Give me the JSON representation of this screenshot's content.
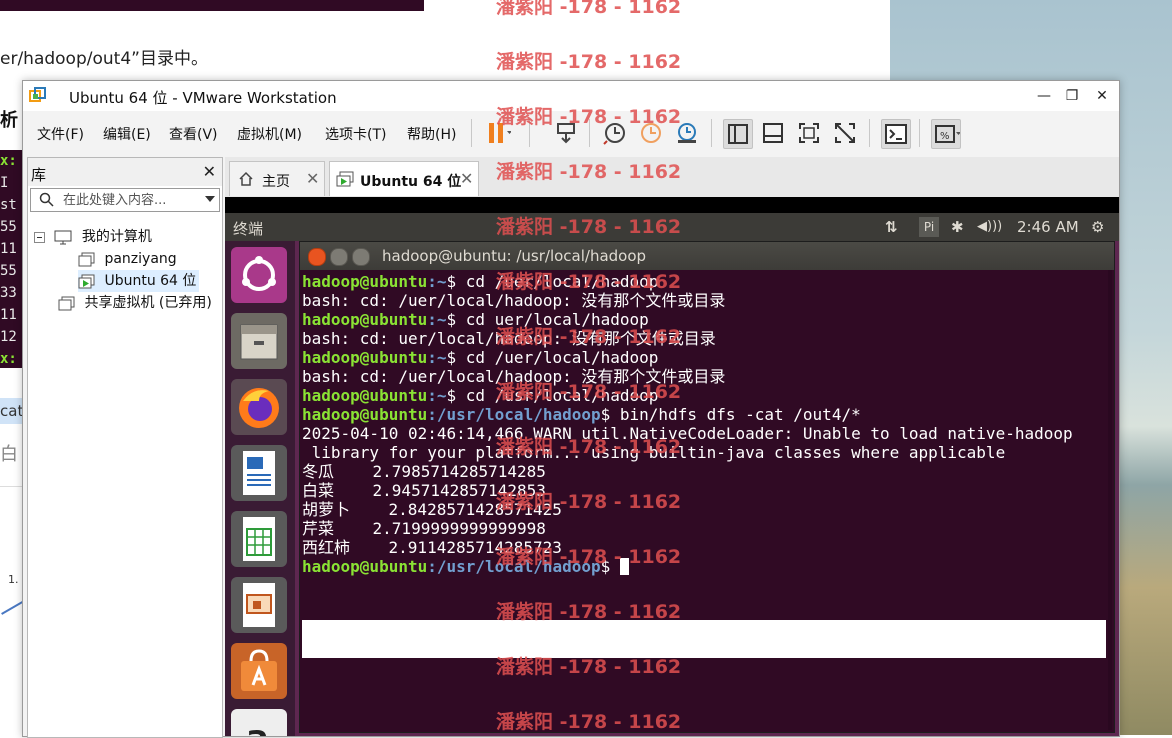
{
  "background": {
    "doc_text": "er/hadoop/out4”目录中。",
    "left_heading": "析",
    "peek_lines": [
      "x:",
      " I",
      "st",
      "55",
      "11",
      "55",
      "33",
      "11",
      "12",
      "x:"
    ],
    "peek_chip": "cat",
    "peek_text": "白",
    "peek_chart_num": "1."
  },
  "window": {
    "title": "Ubuntu 64 位 - VMware Workstation",
    "minimize": "—",
    "restore": "❐",
    "close": "✕"
  },
  "menu": {
    "file": "文件(F)",
    "edit": "编辑(E)",
    "view": "查看(V)",
    "vm": "虚拟机(M)",
    "tabs": "选项卡(T)",
    "help": "帮助(H)"
  },
  "library": {
    "title": "库",
    "close": "✕",
    "search_placeholder": "在此处键入内容...",
    "tree": {
      "my_computer": "我的计算机",
      "vm1": "panziyang",
      "vm2": "Ubuntu 64 位",
      "shared": "共享虚拟机 (已弃用)"
    }
  },
  "tabs": {
    "home": "主页",
    "vm": "Ubuntu 64 位",
    "close": "✕"
  },
  "ubuntu": {
    "top_title": "终端",
    "clock": "2:46 AM",
    "indicators": {
      "network": "⇅",
      "input": "Pi",
      "bluetooth": "✱",
      "volume": "◀)))",
      "settings": "⚙"
    }
  },
  "terminal": {
    "title": "hadoop@ubuntu: /usr/local/hadoop",
    "lines": [
      {
        "user": "hadoop@ubuntu",
        "path": ":~",
        "cmd": "$ cd /uer/local/hadoop"
      },
      {
        "text": "bash: cd: /uer/local/hadoop: 没有那个文件或目录"
      },
      {
        "user": "hadoop@ubuntu",
        "path": ":~",
        "cmd": "$ cd uer/local/hadoop"
      },
      {
        "text": "bash: cd: uer/local/hadoop: 没有那个文件或目录"
      },
      {
        "user": "hadoop@ubuntu",
        "path": ":~",
        "cmd": "$ cd /uer/local/hadoop"
      },
      {
        "text": "bash: cd: /uer/local/hadoop: 没有那个文件或目录"
      },
      {
        "user": "hadoop@ubuntu",
        "path": ":~",
        "cmd": "$ cd /usr/local/hadoop"
      },
      {
        "user": "hadoop@ubuntu",
        "path": ":/usr/local/hadoop",
        "cmd": "$ bin/hdfs dfs -cat /out4/*"
      },
      {
        "text": "2025-04-10 02:46:14,466 WARN util.NativeCodeLoader: Unable to load native-hadoop"
      },
      {
        "text": " library for your platform... using builtin-java classes where applicable"
      },
      {
        "text": "冬瓜\t2.7985714285714285"
      },
      {
        "text": "白菜\t2.9457142857142853"
      },
      {
        "text": "胡萝卜\t2.8428571428571425"
      },
      {
        "text": "芹菜\t2.7199999999999998"
      },
      {
        "text": "西红柿\t2.9114285714285723"
      },
      {
        "user": "hadoop@ubuntu",
        "path": ":/usr/local/hadoop",
        "cmd": "$ ",
        "cursor": true
      }
    ]
  },
  "watermark": "潘紫阳 -178 - 1162",
  "colors": {
    "terminal_bg": "#300a24",
    "prompt_user": "#8ae234",
    "prompt_path": "#729fcf",
    "watermark": "#e05050",
    "launcher_bg": "#3a1b34"
  }
}
